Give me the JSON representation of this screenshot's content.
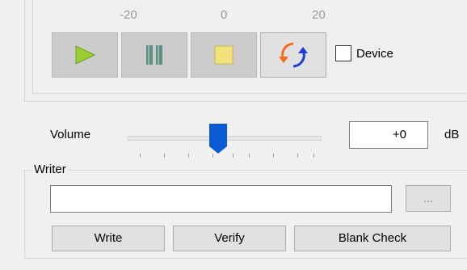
{
  "scale": {
    "labels": [
      "-20",
      "0",
      "20"
    ]
  },
  "transport": {
    "play": "play-icon",
    "pause": "pause-icon",
    "stop": "stop-icon",
    "sync": "sync-icon",
    "device_label": "Device",
    "device_checked": false
  },
  "volume": {
    "label": "Volume",
    "value": "+0",
    "unit": "dB",
    "level": 0.5
  },
  "writer": {
    "group_label": "Writer",
    "path_value": "",
    "browse_label": "...",
    "write_label": "Write",
    "verify_label": "Verify",
    "blank_check_label": "Blank Check"
  },
  "colors": {
    "play": "#9acd32",
    "pause": "#5f8f80",
    "stop": "#f2e27c",
    "slider_thumb": "#0a5bd3",
    "sync_orange": "#f36a1f",
    "sync_blue": "#1f3ad8"
  }
}
